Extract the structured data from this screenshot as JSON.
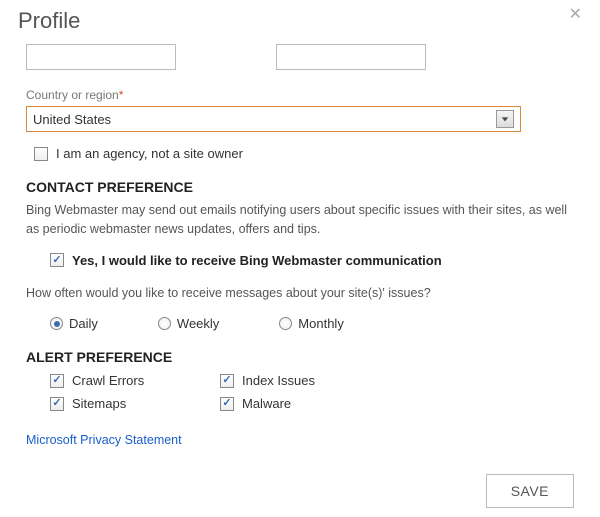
{
  "header": {
    "title": "Profile"
  },
  "fields": {
    "input1": "",
    "input2": "",
    "country_label": "Country or region",
    "country_value": "United States",
    "agency_label": "I am an agency, not a site owner"
  },
  "contact": {
    "heading": "CONTACT PREFERENCE",
    "desc": "Bing Webmaster may send out emails notifying users about specific issues with their sites, as well as periodic webmaster news updates, offers and tips.",
    "optin": "Yes, I would like to receive Bing Webmaster communication",
    "freq_q": "How often would you like to receive messages about your site(s)' issues?",
    "options": {
      "daily": "Daily",
      "weekly": "Weekly",
      "monthly": "Monthly"
    },
    "selected": "daily"
  },
  "alert": {
    "heading": "ALERT PREFERENCE",
    "items": {
      "crawl": "Crawl Errors",
      "index": "Index Issues",
      "sitemaps": "Sitemaps",
      "malware": "Malware"
    }
  },
  "link": {
    "privacy": "Microsoft Privacy Statement"
  },
  "footer": {
    "save": "SAVE"
  }
}
